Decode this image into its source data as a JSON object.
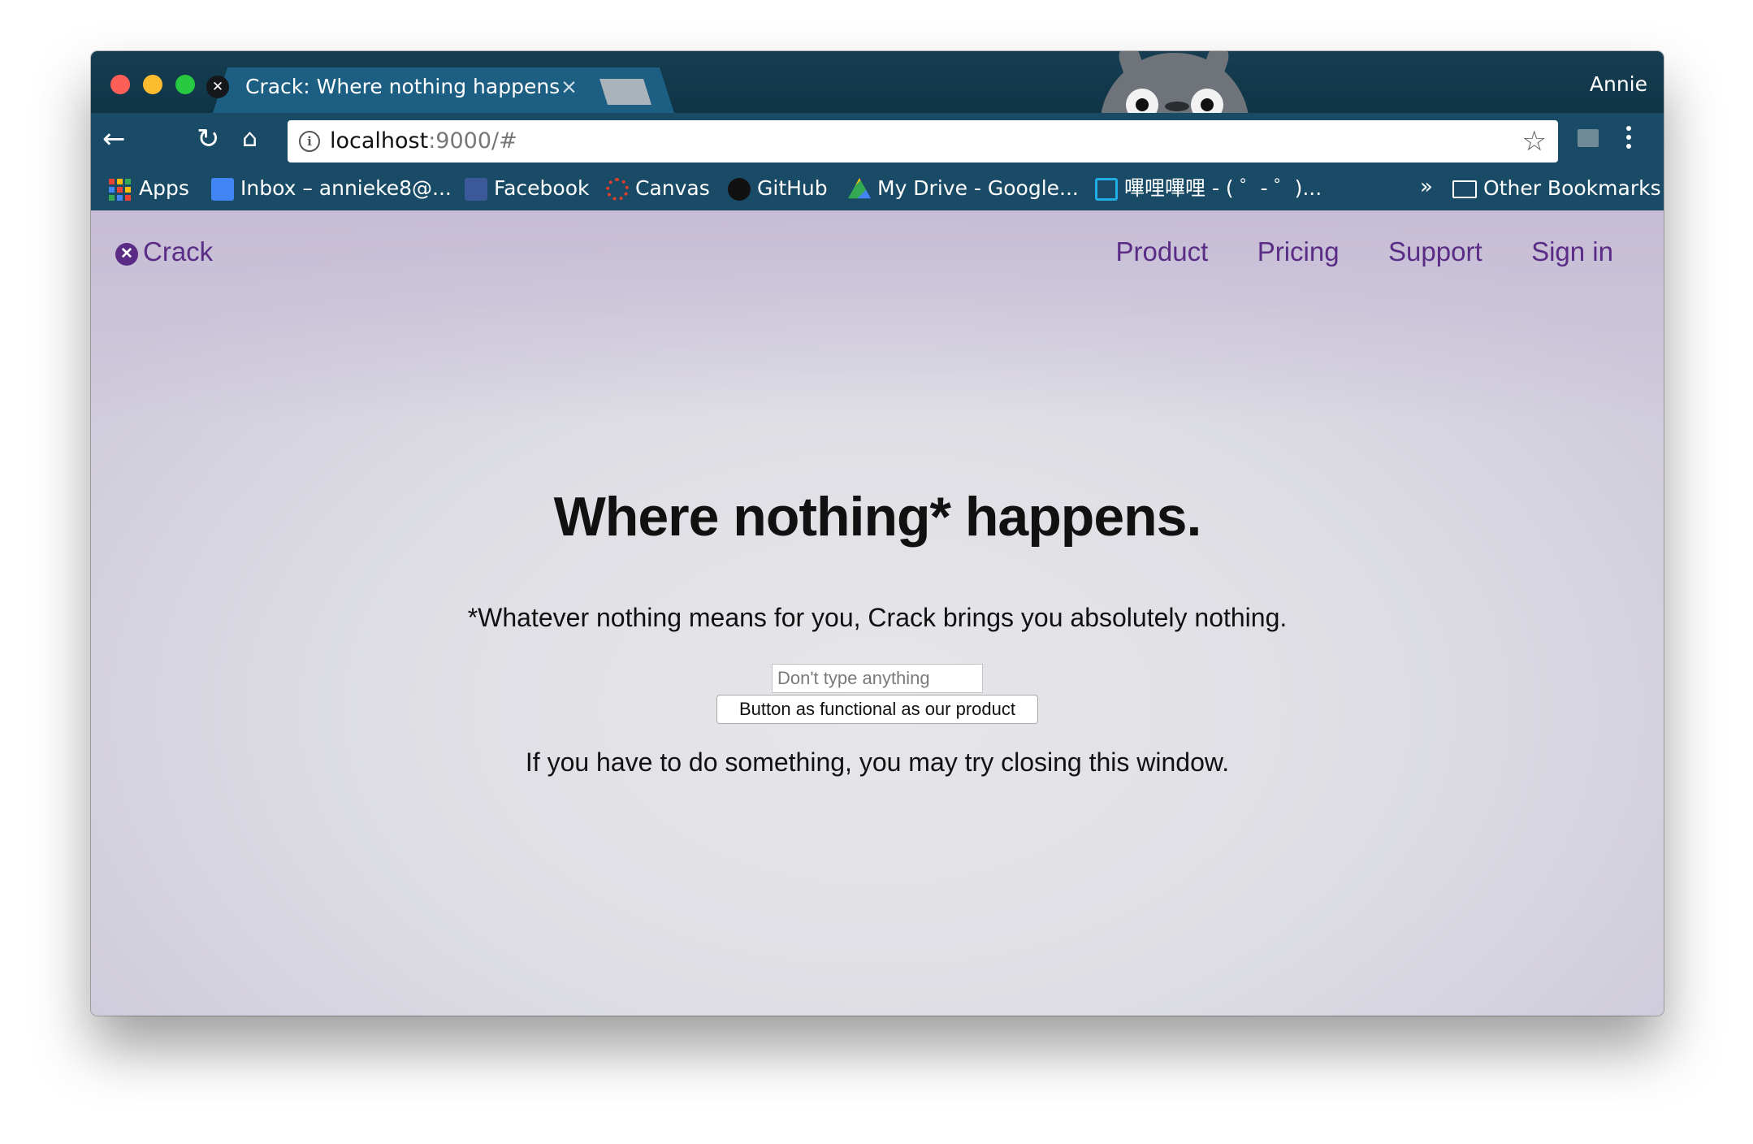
{
  "browser": {
    "tab_title": "Crack: Where nothing happens",
    "tab_close": "×",
    "profile_name": "Annie",
    "url_host": "localhost",
    "url_rest": ":9000/#",
    "bookmarks": [
      {
        "label": "Apps",
        "icon": "apps-grid-icon"
      },
      {
        "label": "Inbox – annieke8@...",
        "icon": "inbox-icon"
      },
      {
        "label": "Facebook",
        "icon": "facebook-icon"
      },
      {
        "label": "Canvas",
        "icon": "canvas-icon"
      },
      {
        "label": "GitHub",
        "icon": "github-icon"
      },
      {
        "label": "My Drive - Google...",
        "icon": "google-drive-icon"
      },
      {
        "label": "嗶哩嗶哩 - ( ゜- ゜)...",
        "icon": "bilibili-icon"
      }
    ],
    "bookmarks_overflow": "»",
    "other_bookmarks": "Other Bookmarks"
  },
  "site": {
    "brand": "Crack",
    "nav": [
      "Product",
      "Pricing",
      "Support",
      "Sign in"
    ],
    "headline": "Where nothing* happens.",
    "subline": "*Whatever nothing means for you, Crack brings you absolutely nothing.",
    "input_placeholder": "Don't type anything",
    "button_label": "Button as functional as our product",
    "closing_text": "If you have to do something, you may try closing this window."
  },
  "colors": {
    "brand_purple": "#5b2c86",
    "chrome_bar": "#1a4b66",
    "tab_active": "#1c5f82"
  }
}
